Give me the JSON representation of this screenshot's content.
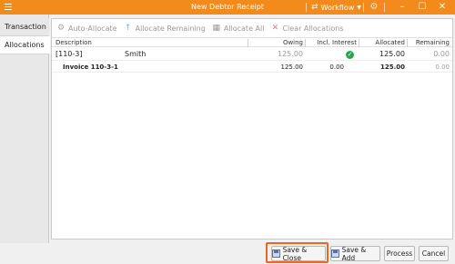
{
  "window": {
    "title": "New Debtor Receipt",
    "workflow_label": "Workflow",
    "minimize": "–",
    "maximize": "☐",
    "close": "✕",
    "accent_color": "#f28a1c"
  },
  "left_tabs": [
    {
      "label": "Transaction",
      "active": false
    },
    {
      "label": "Allocations",
      "active": true
    }
  ],
  "toolbar": {
    "auto_allocate": "Auto-Allocate",
    "allocate_remaining": "Allocate Remaining",
    "allocate_all": "Allocate All",
    "clear_allocations": "Clear Allocations"
  },
  "table": {
    "headers": {
      "description": "Description",
      "owing": "Owing",
      "incl_interest": "Incl. Interest",
      "allocated": "Allocated",
      "remaining": "Remaining"
    },
    "rows": [
      {
        "code": "[110-3]",
        "name": "Smith",
        "owing": "125.00",
        "incl_interest": "",
        "allocated": "125.00",
        "remaining": "0.00"
      },
      {
        "code": "Invoice 110-3-1",
        "owing": "125.00",
        "incl_interest": "0.00",
        "allocated": "125.00",
        "remaining": "0.00"
      }
    ]
  },
  "footer": {
    "save_close": "Save & Close",
    "save_add": "Save & Add",
    "process": "Process",
    "cancel": "Cancel"
  }
}
